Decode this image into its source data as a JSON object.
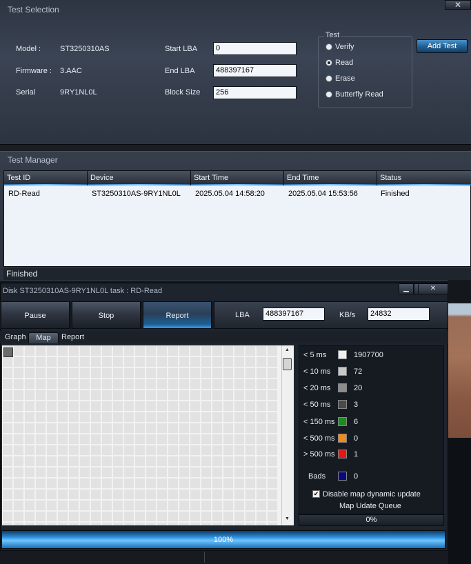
{
  "test_selection": {
    "title": "Test Selection",
    "close_label": "✕",
    "labels": {
      "model": "Model :",
      "firmware": "Firmware :",
      "serial": "Serial",
      "start_lba": "Start LBA",
      "end_lba": "End LBA",
      "block_size": "Block Size"
    },
    "values": {
      "model": "ST3250310AS",
      "firmware": "3.AAC",
      "serial": "9RY1NL0L"
    },
    "inputs": {
      "start_lba": "0",
      "end_lba": "488397167",
      "block_size": "256"
    },
    "test_group": {
      "title": "Test",
      "options": [
        "Verify",
        "Read",
        "Erase",
        "Butterfly Read"
      ],
      "selected": "Read"
    },
    "add_test_label": "Add Test"
  },
  "test_manager": {
    "title": "Test Manager",
    "columns": [
      "Test ID",
      "Device",
      "Start Time",
      "End Time",
      "Status"
    ],
    "rows": [
      {
        "test_id": "RD-Read",
        "device": "ST3250310AS-9RY1NL0L",
        "start": "2025.05.04 14:58:20",
        "end": "2025.05.04 15:53:56",
        "status": "Finished"
      }
    ],
    "status": "Finished"
  },
  "disk_window": {
    "title": "Disk ST3250310AS-9RY1NL0L   task : RD-Read",
    "buttons": {
      "pause": "Pause",
      "stop": "Stop",
      "report": "Report"
    },
    "lba_label": "LBA",
    "lba_value": "488397167",
    "kbs_label": "KB/s",
    "kbs_value": "24832",
    "tabs": [
      "Graph",
      "Map",
      "Report"
    ],
    "active_tab": "Map",
    "legend": [
      {
        "label": "< 5 ms",
        "color": "#f0f0f0",
        "value": "1907700"
      },
      {
        "label": "< 10 ms",
        "color": "#c8c8c8",
        "value": "72"
      },
      {
        "label": "< 20 ms",
        "color": "#8c8c8c",
        "value": "20"
      },
      {
        "label": "< 50 ms",
        "color": "#4a4a4a",
        "value": "3"
      },
      {
        "label": "< 150 ms",
        "color": "#1f8a1f",
        "value": "6"
      },
      {
        "label": "< 500 ms",
        "color": "#f08a1e",
        "value": "0"
      },
      {
        "label": "> 500 ms",
        "color": "#e01818",
        "value": "1"
      },
      {
        "label": "Bads",
        "color": "#0a0a7a",
        "value": "0"
      }
    ],
    "disable_map_label": "Disable map dynamic update",
    "disable_map_checked": true,
    "queue_label": "Map Udate Queue",
    "queue_value": "0%",
    "progress_label": "100%",
    "progress_fraction": 1.0
  }
}
